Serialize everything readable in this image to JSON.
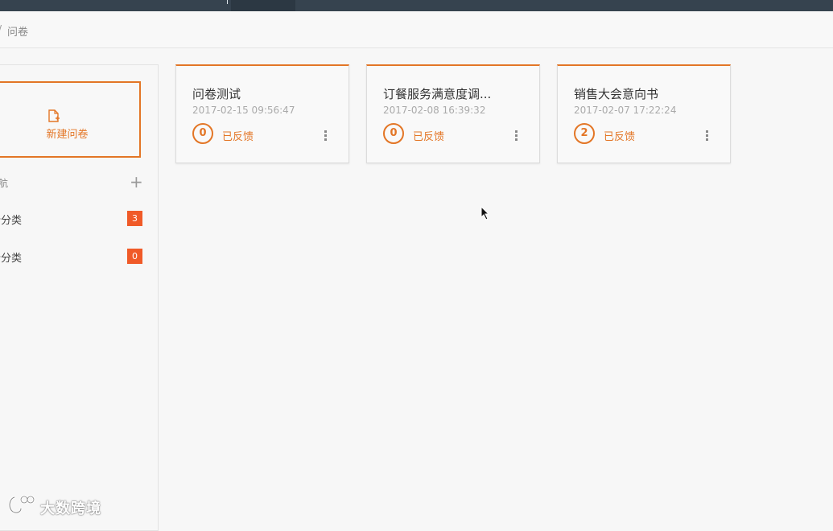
{
  "breadcrumb": {
    "separator": "/",
    "current": "问卷"
  },
  "sidebar": {
    "new_button_label": "新建问卷",
    "nav_header": "导航",
    "add_label": "+",
    "items": [
      {
        "label": "新分类",
        "count": "3"
      },
      {
        "label": "新分类",
        "count": "0"
      }
    ]
  },
  "cards": [
    {
      "title": "问卷测试",
      "date": "2017-02-15 09:56:47",
      "count": "0",
      "feedback_label": "已反馈"
    },
    {
      "title": "订餐服务满意度调...",
      "date": "2017-02-08 16:39:32",
      "count": "0",
      "feedback_label": "已反馈"
    },
    {
      "title": "销售大会意向书",
      "date": "2017-02-07 17:22:24",
      "count": "2",
      "feedback_label": "已反馈"
    }
  ],
  "watermark": {
    "text": "大数跨境"
  },
  "colors": {
    "accent": "#e37626",
    "badge": "#f05a28",
    "topbar": "#36434f"
  }
}
